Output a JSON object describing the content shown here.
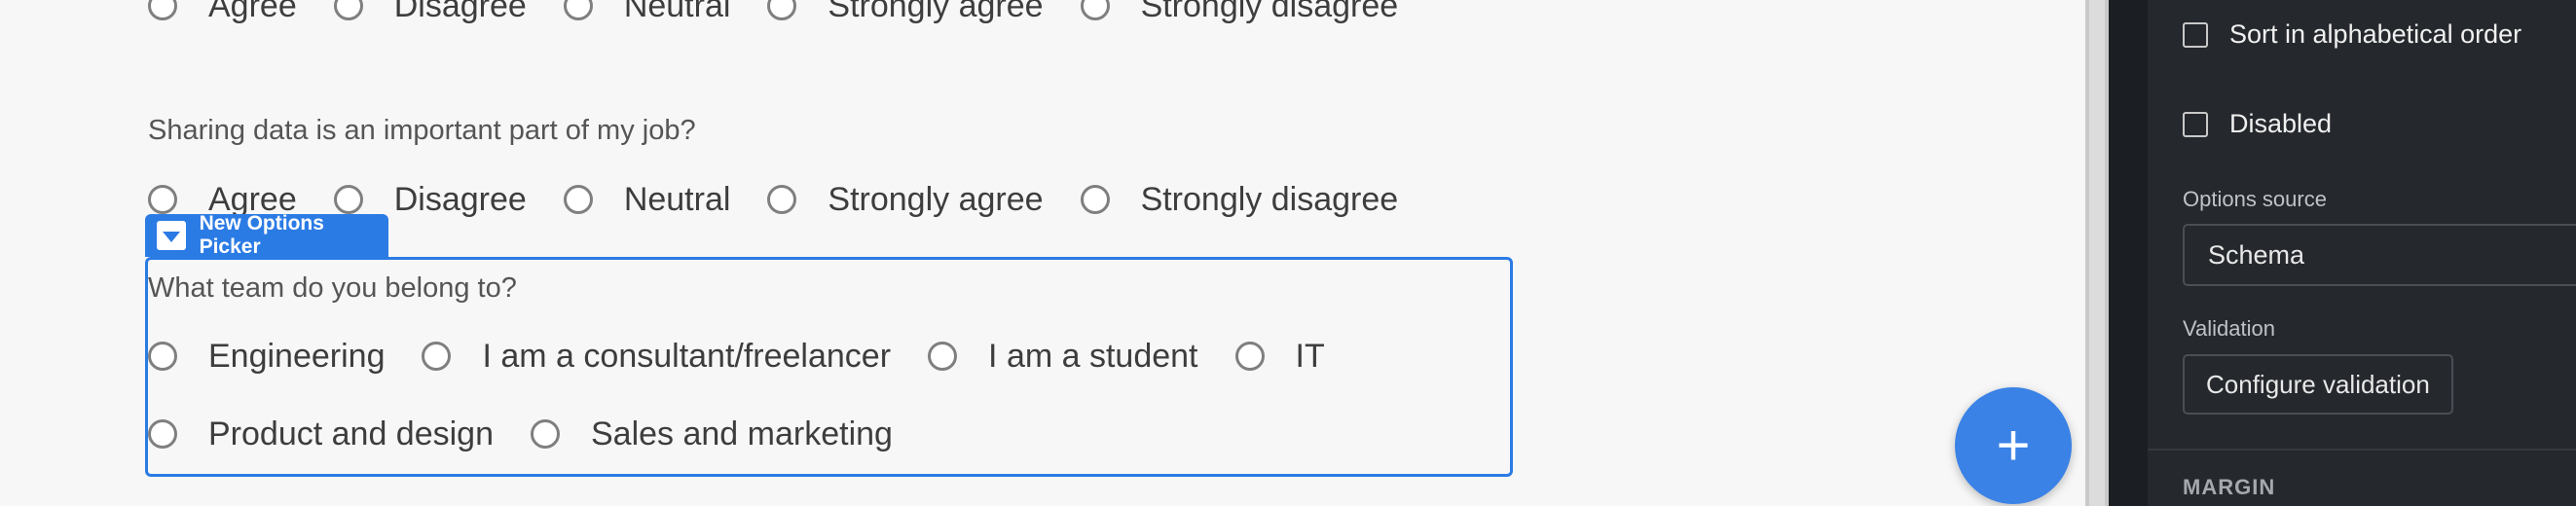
{
  "form": {
    "questions": [
      {
        "label": "",
        "options": [
          "Agree",
          "Disagree",
          "Neutral",
          "Strongly agree",
          "Strongly disagree"
        ]
      },
      {
        "label": "Sharing data is an important part of my job?",
        "options": [
          "Agree",
          "Disagree",
          "Neutral",
          "Strongly agree",
          "Strongly disagree"
        ]
      },
      {
        "label": "What team do you belong to?",
        "options_row1": [
          "Engineering",
          "I am a consultant/freelancer",
          "I am a student",
          "IT"
        ],
        "options_row2": [
          "Product and design",
          "Sales and marketing"
        ]
      }
    ],
    "selected_tag": "New Options Picker",
    "fab_symbol": "+"
  },
  "panel": {
    "sort_label": "Sort in alphabetical order",
    "disabled_label": "Disabled",
    "options_source_label": "Options source",
    "options_source_value": "Schema",
    "validation_label": "Validation",
    "validation_button": "Configure validation",
    "margin_section": "MARGIN"
  },
  "colors": {
    "accent": "#2b7be5",
    "panel_bg": "#25282d",
    "canvas_bg": "#f7f7f7"
  }
}
